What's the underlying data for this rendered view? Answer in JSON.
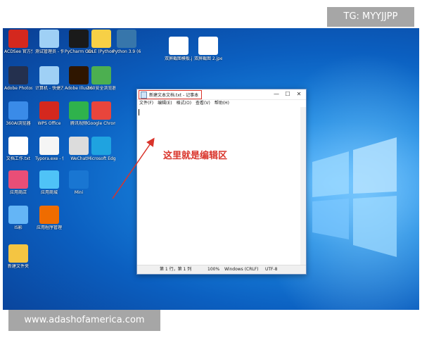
{
  "watermarks": {
    "top": "TG: MYYJJPP",
    "bottom": "www.adashofamerica.com"
  },
  "desktop_icons": [
    {
      "label": "ACDSee 官方免费版",
      "icon": "acdsee-icon",
      "color": "#d4281e"
    },
    {
      "label": "测试管理员 - 快捷方式",
      "icon": "computer-icon",
      "color": "#9fd0f5"
    },
    {
      "label": "PyCharm Commun...",
      "icon": "pycharm-icon",
      "color": "#1a1a1a"
    },
    {
      "label": "IDLE (Python 3.9 64-bit)",
      "icon": "python-idle-icon",
      "color": "#f7d046"
    },
    {
      "label": "Python 3.9 (64-bit)",
      "icon": "python-icon",
      "color": "#3776ab"
    },
    {
      "label": "Adobe Photosho...",
      "icon": "photoshop-icon",
      "color": "#24304e"
    },
    {
      "label": "计算机 - 快捷方式",
      "icon": "computer-icon",
      "color": "#9fd0f5"
    },
    {
      "label": "Adobe Illustrat...",
      "icon": "illustrator-icon",
      "color": "#2f1600"
    },
    {
      "label": "360安全浏览器",
      "icon": "browser-360-icon",
      "color": "#4caf50"
    },
    {
      "label": "360AI浏览器",
      "icon": "browser-360-ai-icon",
      "color": "#3a8be8"
    },
    {
      "label": "WPS Office",
      "icon": "wps-icon",
      "color": "#d4281e"
    },
    {
      "label": "腾讯视频",
      "icon": "video-icon",
      "color": "#2fb24c"
    },
    {
      "label": "Google Chrome",
      "icon": "chrome-icon",
      "color": "#e8453c"
    },
    {
      "label": "文档工作.txt",
      "icon": "document-icon",
      "color": "#ffffff"
    },
    {
      "label": "Typora.exe - 快捷方式",
      "icon": "typora-icon",
      "color": "#f5f5f5"
    },
    {
      "label": "WeChat",
      "icon": "wechat-icon",
      "color": "#dcdcdc"
    },
    {
      "label": "Microsoft Edge",
      "icon": "edge-icon",
      "color": "#1fa3e0"
    },
    {
      "label": "应用商店",
      "icon": "store-icon",
      "color": "#e94e77"
    },
    {
      "label": "应用商城",
      "icon": "appstore-icon",
      "color": "#4fc3f7"
    },
    {
      "label": "Mini",
      "icon": "mini-icon",
      "color": "#1976d2"
    },
    {
      "label": "IS影",
      "icon": "tool-icon",
      "color": "#64b5f6"
    },
    {
      "label": "应用程序管理",
      "icon": "app-manager-icon",
      "color": "#ef6c00"
    },
    {
      "label": "新建文件夹",
      "icon": "folder-icon",
      "color": "#f4c542"
    },
    {
      "label": "双屏截图模板.jpeg",
      "icon": "image-file-icon",
      "color": "#ffffff"
    },
    {
      "label": "双屏截图 2.jpeg",
      "icon": "image-file-icon",
      "color": "#ffffff"
    }
  ],
  "notepad": {
    "title": "新建文本文档.txt - 记事本",
    "menu": [
      "文件(F)",
      "编辑(E)",
      "格式(O)",
      "查看(V)",
      "帮助(H)"
    ],
    "status": {
      "position": "第 1 行，第 1 列",
      "zoom": "100%",
      "line_ending": "Windows (CRLF)",
      "encoding": "UTF-8"
    },
    "controls": {
      "minimize": "—",
      "maximize": "☐",
      "close": "✕"
    }
  },
  "annotation": {
    "text": "这里就是编辑区",
    "color": "#d9342b"
  }
}
